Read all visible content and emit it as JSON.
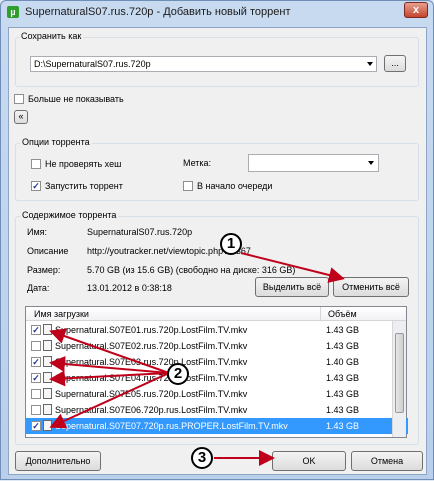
{
  "window": {
    "title": "SupernaturalS07.rus.720p - Добавить новый торрент",
    "close_glyph": "x"
  },
  "save_as": {
    "label": "Сохранить как",
    "path": "D:\\SupernaturalS07.rus.720p",
    "browse_label": "..."
  },
  "dont_show_label": "Больше не показывать",
  "collapse_glyph": "«",
  "options": {
    "label": "Опции торрента",
    "no_hash_check": "Не проверять хеш",
    "start_torrent": "Запустить торрент",
    "tag_label": "Метка:",
    "queue_top": "В начало очереди"
  },
  "contents": {
    "label": "Содержимое торрента",
    "name_label": "Имя:",
    "name_value": "SupernaturalS07.rus.720p",
    "desc_label": "Описание",
    "desc_value": "http://youtracker.net/viewtopic.php?t=367",
    "size_label": "Размер:",
    "size_value": "5.70 GB (из 15.6 GB) (свободно на диске: 316 GB)",
    "date_label": "Дата:",
    "date_value": "13.01.2012 в 0:38:18",
    "select_all": "Выделить всё",
    "deselect_all": "Отменить всё"
  },
  "file_list": {
    "col_name": "Имя загрузки",
    "col_size": "Объём",
    "rows": [
      {
        "name": "Supernatural.S07E01.rus.720p.LostFilm.TV.mkv",
        "size": "1.43 GB",
        "checked": true
      },
      {
        "name": "Supernatural.S07E02.rus.720p.LostFilm.TV.mkv",
        "size": "1.43 GB",
        "checked": false
      },
      {
        "name": "Supernatural.S07E03.rus.720p.LostFilm.TV.mkv",
        "size": "1.40 GB",
        "checked": true
      },
      {
        "name": "Supernatural.S07E04.rus.720p.LostFilm.TV.mkv",
        "size": "1.43 GB",
        "checked": true
      },
      {
        "name": "Supernatural.S07E05.rus.720p.LostFilm.TV.mkv",
        "size": "1.43 GB",
        "checked": false
      },
      {
        "name": "Supernatural.S07E06.720p.rus.LostFilm.TV.mkv",
        "size": "1.43 GB",
        "checked": false
      },
      {
        "name": "Supernatural.S07E07.720p.rus.PROPER.LostFilm.TV.mkv",
        "size": "1.43 GB",
        "checked": true
      }
    ]
  },
  "buttons": {
    "advanced": "Дополнительно",
    "ok": "OK",
    "cancel": "Отмена"
  },
  "annotations": [
    "1",
    "2",
    "3"
  ],
  "colors": {
    "arrow": "#c0001a",
    "selection": "#3399ff"
  }
}
